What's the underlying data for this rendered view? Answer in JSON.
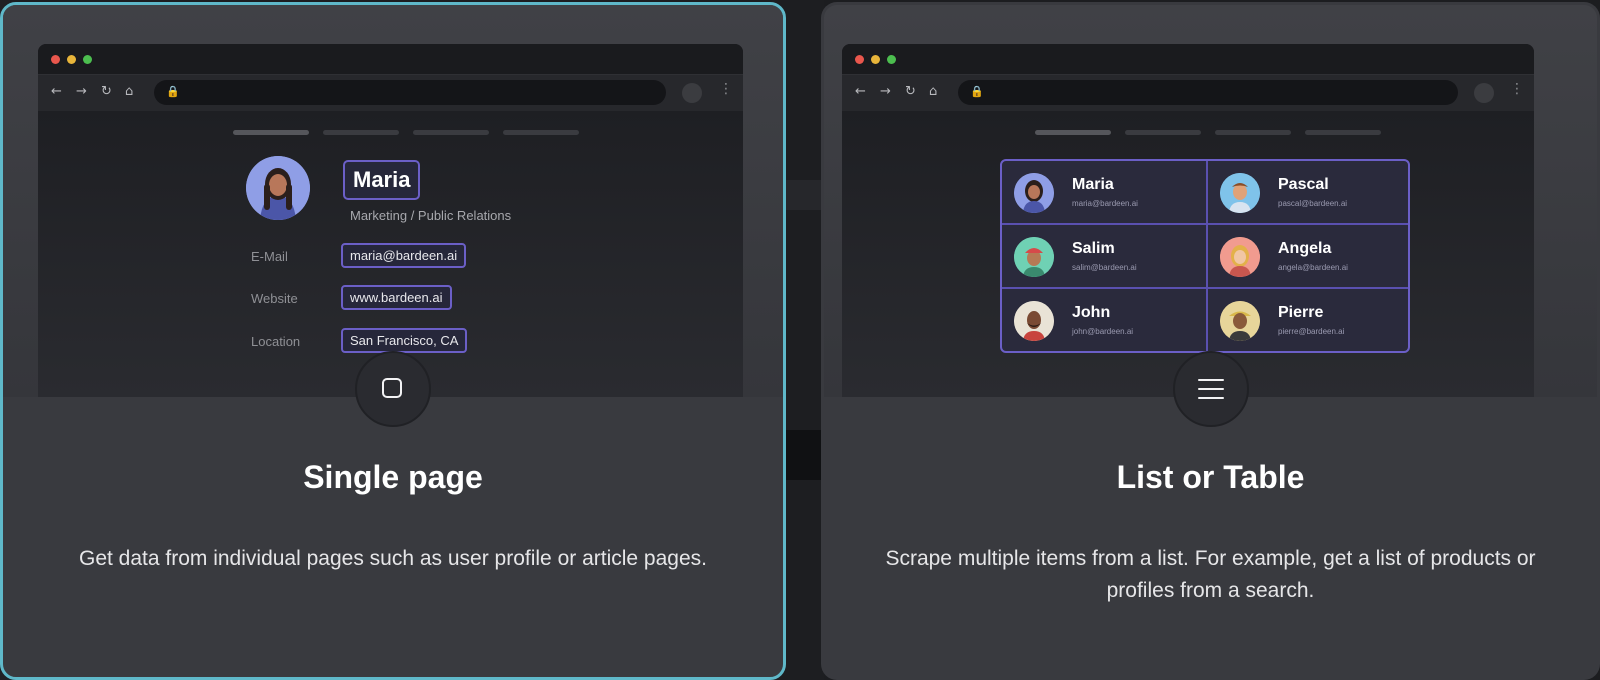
{
  "cards": {
    "single": {
      "title": "Single page",
      "description": "Get data from individual pages such as user profile or article pages.",
      "icon": "square-icon",
      "selected": true,
      "profile": {
        "name": "Maria",
        "role": "Marketing / Public Relations",
        "fields": [
          {
            "label": "E-Mail",
            "value": "maria@bardeen.ai"
          },
          {
            "label": "Website",
            "value": "www.bardeen.ai"
          },
          {
            "label": "Location",
            "value": "San Francisco, CA"
          }
        ]
      }
    },
    "list": {
      "title": "List or Table",
      "description": "Scrape multiple items from a list. For example, get a list of products or profiles from a search.",
      "icon": "list-icon",
      "selected": false,
      "people": [
        {
          "name": "Maria",
          "email": "maria@bardeen.ai"
        },
        {
          "name": "Pascal",
          "email": "pascal@bardeen.ai"
        },
        {
          "name": "Salim",
          "email": "salim@bardeen.ai"
        },
        {
          "name": "Angela",
          "email": "angela@bardeen.ai"
        },
        {
          "name": "John",
          "email": "john@bardeen.ai"
        },
        {
          "name": "Pierre",
          "email": "pierre@bardeen.ai"
        }
      ]
    }
  },
  "colors": {
    "selected_border": "#5fb8c9",
    "highlight_border": "#6b5fc7",
    "card_bg": "#393a3f"
  }
}
